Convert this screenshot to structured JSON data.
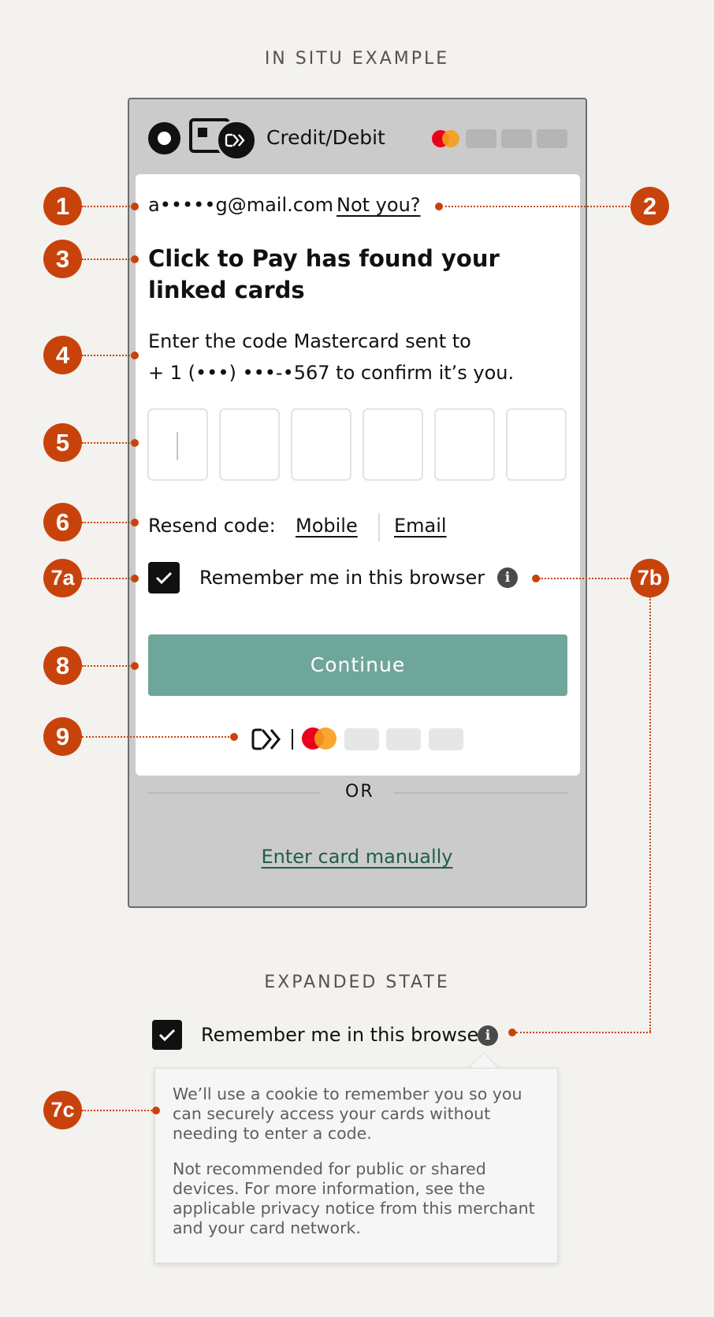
{
  "titles": {
    "in_situ": "IN SITU EXAMPLE",
    "expanded": "EXPANDED STATE"
  },
  "header": {
    "payment_label": "Credit/Debit"
  },
  "identity": {
    "email": "a•••••g@mail.com",
    "not_you": "Not you?"
  },
  "heading": "Click to Pay has found your linked cards",
  "description": {
    "line1": "Enter the code Mastercard sent to",
    "line2": "+ 1 (•••) •••-•567 to confirm it’s you."
  },
  "resend": {
    "label": "Resend code:",
    "mobile": "Mobile",
    "email": "Email"
  },
  "remember": {
    "label": "Remember me in this browser",
    "checked": true
  },
  "continue_label": "Continue",
  "or_label": "OR",
  "manual_link": "Enter card manually",
  "tooltip": {
    "paragraph1": "We’ll use a cookie to remember you so you can securely access your cards without needing to enter a code.",
    "paragraph2": "Not recommended for public or shared devices. For more information, see the applicable privacy notice from this merchant and your card network."
  },
  "markers": [
    "1",
    "2",
    "3",
    "4",
    "5",
    "6",
    "7a",
    "7b",
    "8",
    "9",
    "7c"
  ],
  "icons": {
    "info": "i"
  },
  "colors": {
    "accent": "#c8430b",
    "button": "#6fa69b",
    "link": "#1f5d4d",
    "mc_red": "#eb001b",
    "mc_orange": "#f79e1b"
  }
}
